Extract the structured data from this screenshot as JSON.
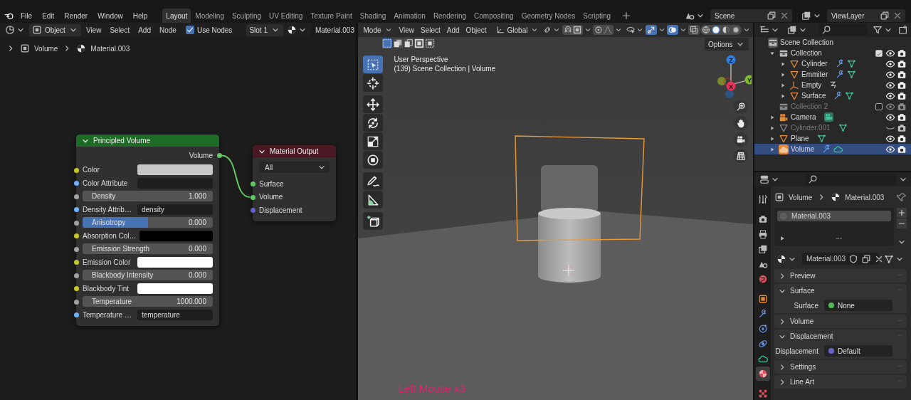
{
  "top_bar": {
    "menus": [
      "File",
      "Edit",
      "Render",
      "Window",
      "Help"
    ],
    "workspaces": [
      {
        "label": "Layout",
        "selected": true
      },
      {
        "label": "Modeling",
        "selected": false
      },
      {
        "label": "Sculpting",
        "selected": false
      },
      {
        "label": "UV Editing",
        "selected": false
      },
      {
        "label": "Texture Paint",
        "selected": false
      },
      {
        "label": "Shading",
        "selected": false
      },
      {
        "label": "Animation",
        "selected": false
      },
      {
        "label": "Rendering",
        "selected": false
      },
      {
        "label": "Compositing",
        "selected": false
      },
      {
        "label": "Geometry Nodes",
        "selected": false
      },
      {
        "label": "Scripting",
        "selected": false
      }
    ],
    "scene": "Scene",
    "view_layer": "ViewLayer"
  },
  "node_editor": {
    "header": {
      "mode": "Object",
      "menus": [
        "View",
        "Select",
        "Add",
        "Node"
      ],
      "use_nodes": {
        "label": "Use Nodes",
        "checked": true
      },
      "slot": "Slot 1",
      "material": "Material.003"
    },
    "breadcrumb": [
      "Volume",
      "Material.003"
    ],
    "nodes": [
      {
        "kind": "principled",
        "title": "Principled Volume",
        "outputs": [
          {
            "label": "Volume",
            "kind": "shader"
          }
        ],
        "inputs": [
          {
            "label": "Color",
            "kind": "color",
            "color": "#c8c8c8"
          },
          {
            "label": "Color Attribute",
            "kind": "text"
          },
          {
            "label": "Density",
            "kind": "number",
            "value": "1.000"
          },
          {
            "label": "Density Attrib…",
            "kind": "text",
            "value": "density"
          },
          {
            "label": "Anisotropy",
            "kind": "slider",
            "value": "0.000",
            "level": 0.5
          },
          {
            "label": "Absorption Col…",
            "kind": "color",
            "color": "#000000"
          },
          {
            "label": "Emission Strength",
            "kind": "number",
            "value": "0.000"
          },
          {
            "label": "Emission Color",
            "kind": "color",
            "color": "#ffffff"
          },
          {
            "label": "Blackbody Intensity",
            "kind": "number",
            "value": "0.000"
          },
          {
            "label": "Blackbody Tint",
            "kind": "color",
            "color": "#ffffff"
          },
          {
            "label": "Temperature",
            "kind": "number",
            "value": "1000.000"
          },
          {
            "label": "Temperature …",
            "kind": "text",
            "value": "temperature"
          }
        ]
      },
      {
        "kind": "output",
        "title": "Material Output",
        "target": "All",
        "inputs": [
          {
            "label": "Surface",
            "kind": "shader"
          },
          {
            "label": "Volume",
            "kind": "shader",
            "linked": true
          },
          {
            "label": "Displacement",
            "kind": "vector"
          }
        ]
      }
    ]
  },
  "viewport": {
    "header": {
      "mode": "Mode",
      "menus": [
        "View",
        "Select",
        "Add",
        "Object"
      ],
      "orientation": "Global",
      "toggles": [
        {
          "kind": "snap",
          "on": false
        },
        {
          "kind": "proportional",
          "on": false
        },
        {
          "kind": "gizmo",
          "on": true
        },
        {
          "kind": "overlay",
          "on": true
        },
        {
          "kind": "xray",
          "on": false
        }
      ],
      "shading": [
        {
          "kind": "wireframe",
          "selected": false
        },
        {
          "kind": "solid",
          "selected": true
        },
        {
          "kind": "material",
          "selected": false
        },
        {
          "kind": "rendered",
          "selected": false
        }
      ]
    },
    "select_modes": [
      {
        "selected": true
      },
      {
        "selected": false
      },
      {
        "selected": false
      },
      {
        "selected": false
      },
      {
        "selected": false
      }
    ],
    "options": "Options",
    "view_name": "User Perspective",
    "view_info": "(139) Scene Collection | Volume",
    "tool_groups": [
      [
        {
          "kind": "select_box",
          "selected": true
        },
        {
          "kind": "cursor",
          "selected": false
        }
      ],
      [
        {
          "kind": "move",
          "selected": false
        },
        {
          "kind": "rotate",
          "selected": false
        },
        {
          "kind": "scale",
          "selected": false
        },
        {
          "kind": "transform",
          "selected": false
        }
      ],
      [
        {
          "kind": "annotate",
          "selected": false
        },
        {
          "kind": "measure",
          "selected": false
        }
      ],
      [
        {
          "kind": "add_cube",
          "selected": false
        }
      ]
    ],
    "gizmo": {
      "z": "Z",
      "y": "Y",
      "x": "X"
    },
    "keystroke": "Left Mouse x3"
  },
  "outliner": {
    "items": [
      {
        "label": "Scene Collection",
        "kind": "scene_collection",
        "selected": false,
        "children": [
          {
            "label": "Collection",
            "kind": "collection",
            "expanded": true,
            "checked": true,
            "visible": true,
            "disabled": false,
            "selected": false,
            "children": [
              {
                "label": "Cylinder",
                "kind": "mesh",
                "expanded": false,
                "visible": true,
                "disabled": false,
                "selected": false,
                "badges": [
                  {
                    "kind": "modifier"
                  },
                  {
                    "kind": "mesh_data"
                  }
                ]
              },
              {
                "label": "Emmiter",
                "kind": "mesh",
                "expanded": false,
                "visible": true,
                "disabled": false,
                "selected": false,
                "badges": [
                  {
                    "kind": "modifier"
                  },
                  {
                    "kind": "mesh_data"
                  }
                ]
              },
              {
                "label": "Empty",
                "kind": "empty",
                "expanded": false,
                "visible": true,
                "disabled": false,
                "selected": false,
                "badges": [
                  {
                    "kind": "curve"
                  }
                ]
              },
              {
                "label": "Surface",
                "kind": "mesh",
                "expanded": false,
                "visible": true,
                "disabled": false,
                "selected": false,
                "badges": [
                  {
                    "kind": "modifier"
                  },
                  {
                    "kind": "mesh_data"
                  }
                ]
              }
            ]
          },
          {
            "label": "Collection 2",
            "kind": "collection",
            "checked": false,
            "visible": true,
            "disabled": true,
            "selected": false
          },
          {
            "label": "Camera",
            "kind": "camera",
            "expanded": false,
            "visible": true,
            "disabled": false,
            "selected": false,
            "badges": [
              {
                "kind": "camera_data"
              }
            ]
          },
          {
            "label": "Cylinder.001",
            "kind": "mesh",
            "expanded": false,
            "visible": false,
            "disabled": true,
            "selected": false,
            "badges": [
              {
                "kind": "mesh_data"
              }
            ]
          },
          {
            "label": "Plane",
            "kind": "mesh",
            "expanded": false,
            "visible": true,
            "disabled": false,
            "selected": false,
            "badges": [
              {
                "kind": "mesh_data"
              }
            ]
          },
          {
            "label": "Volume",
            "kind": "volume",
            "expanded": false,
            "visible": true,
            "disabled": false,
            "selected": true,
            "badges": [
              {
                "kind": "modifier"
              },
              {
                "kind": "volume_data"
              }
            ]
          }
        ]
      }
    ]
  },
  "properties": {
    "tab_groups": [
      [
        {
          "kind": "tool",
          "selected": false
        }
      ],
      [
        {
          "kind": "render",
          "selected": false
        },
        {
          "kind": "output",
          "selected": false
        },
        {
          "kind": "view_layer",
          "selected": false
        },
        {
          "kind": "scene",
          "selected": false
        },
        {
          "kind": "world",
          "selected": false
        }
      ],
      [
        {
          "kind": "object",
          "selected": false
        },
        {
          "kind": "modifiers",
          "selected": false
        },
        {
          "kind": "particles",
          "selected": false
        },
        {
          "kind": "physics",
          "selected": false
        },
        {
          "kind": "data",
          "selected": false
        },
        {
          "kind": "material",
          "selected": true
        }
      ],
      [
        {
          "kind": "texture",
          "selected": false
        }
      ]
    ],
    "breadcrumb": [
      "Volume",
      "Material.003"
    ],
    "slots": [
      {
        "label": "Material.003",
        "selected": true
      }
    ],
    "material": "Material.003",
    "panels": [
      {
        "title": "Preview",
        "expanded": false
      },
      {
        "title": "Surface",
        "expanded": true,
        "fields": [
          {
            "label": "Surface",
            "value": "None",
            "color": "#4dbb4d"
          }
        ]
      },
      {
        "title": "Volume",
        "expanded": false
      },
      {
        "title": "Displacement",
        "expanded": true,
        "fields": [
          {
            "label": "Displacement",
            "value": "Default",
            "color": "#6a63c9"
          }
        ]
      },
      {
        "title": "Settings",
        "expanded": false
      },
      {
        "title": "Line Art",
        "expanded": false
      }
    ]
  }
}
